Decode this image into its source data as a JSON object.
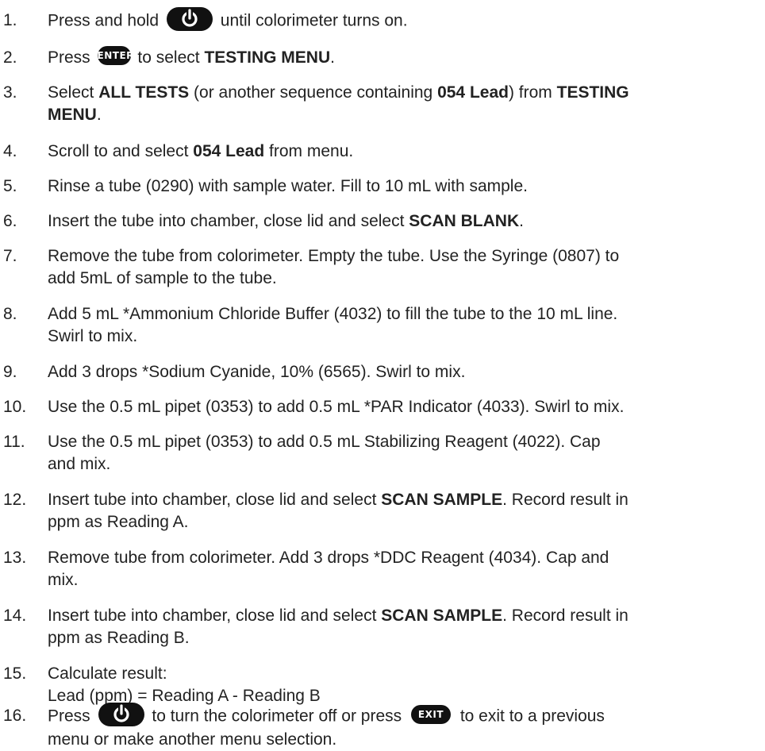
{
  "steps": [
    {
      "n": "1.",
      "t1": "Press and hold",
      "icon1": "power-icon",
      "t2": "until colorimeter turns on."
    },
    {
      "n": "2.",
      "t1": "Press",
      "icon1": "enter-button",
      "icon1_label": "ENTER",
      "t2": "to select",
      "b1": "TESTING MENU",
      "t3": "."
    },
    {
      "n": "3.",
      "t1": "Select",
      "b1": "ALL TESTS",
      "t2": "(or another sequence containing",
      "b2": "054 Lead",
      "t3": ") from",
      "b3": "TESTING",
      "b3b": "MENU",
      "t4": "."
    },
    {
      "n": "4.",
      "t1": "Scroll to and select",
      "b1": "054 Lead",
      "t2": "from menu."
    },
    {
      "n": "5.",
      "t1": "Rinse a tube (0290) with sample water. Fill to 10 mL with sample."
    },
    {
      "n": "6.",
      "t1": "Insert the tube into chamber, close lid and select",
      "b1": "SCAN BLANK",
      "t2": "."
    },
    {
      "n": "7.",
      "l1": "Remove the tube from colorimeter. Empty the tube. Use the Syringe (0807) to",
      "l2": "add 5mL of sample to the tube."
    },
    {
      "n": "8.",
      "l1": "Add 5 mL *Ammonium Chloride Buffer (4032) to fill the tube to the 10 mL line.",
      "l2": "Swirl to mix."
    },
    {
      "n": "9.",
      "t1": "Add 3 drops *Sodium Cyanide, 10% (6565). Swirl to mix."
    },
    {
      "n": "10.",
      "t1": "Use the 0.5 mL pipet (0353) to add 0.5 mL *PAR Indicator (4033). Swirl to mix."
    },
    {
      "n": "11.",
      "l1": "Use the 0.5 mL pipet (0353) to add 0.5 mL Stabilizing Reagent (4022). Cap",
      "l2": "and mix."
    },
    {
      "n": "12.",
      "t1": "Insert tube into chamber, close lid and select",
      "b1": "SCAN SAMPLE",
      "t2": ". Record result in",
      "l2": "ppm as Reading A."
    },
    {
      "n": "13.",
      "l1": "Remove tube from colorimeter. Add 3 drops *DDC Reagent (4034). Cap and",
      "l2": "mix."
    },
    {
      "n": "14.",
      "t1": "Insert tube into chamber, close lid and select",
      "b1": "SCAN SAMPLE",
      "t2": ". Record result in",
      "l2": "ppm as Reading B."
    },
    {
      "n": "15.",
      "l1": "Calculate result:",
      "l2": "Lead (ppm) = Reading A - Reading B"
    },
    {
      "n": "16.",
      "t1": "Press",
      "icon1": "power-icon",
      "t2": "to turn the colorimeter off or press",
      "icon2": "exit-button",
      "icon2_label": "EXIT",
      "t3": "to exit to a previous",
      "l2": "menu or make another menu selection."
    }
  ],
  "colors": {
    "text": "#222222",
    "button_fill": "#111111",
    "button_text": "#ffffff"
  }
}
